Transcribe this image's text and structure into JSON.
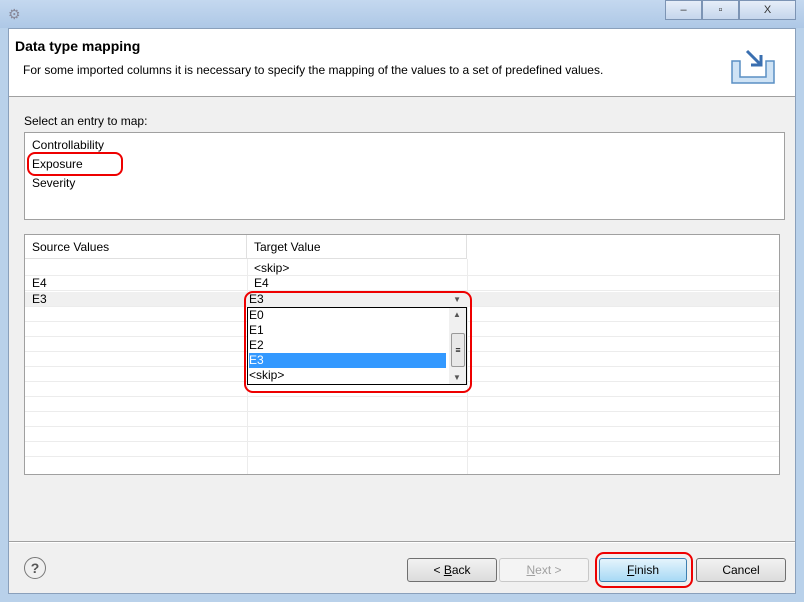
{
  "window": {
    "buttons": [
      "minimize",
      "maximize",
      "close"
    ]
  },
  "header": {
    "title": "Data type mapping",
    "description": "For some imported columns it is necessary to specify the mapping of the values to a set of predefined values."
  },
  "select_label": "Select an entry to map:",
  "entries": [
    "Controllability",
    "Exposure",
    "Severity"
  ],
  "table": {
    "columns": [
      "Source Values",
      "Target Value"
    ],
    "rows": [
      {
        "source": "",
        "target": "<skip>"
      },
      {
        "source": "E4",
        "target": "E4"
      },
      {
        "source": "E3",
        "target": "E3"
      }
    ]
  },
  "dropdown": {
    "options": [
      "E0",
      "E1",
      "E2",
      "E3",
      "<skip>"
    ],
    "selected": "E3"
  },
  "buttons": {
    "back_prefix": "< ",
    "back_u": "B",
    "back_rest": "ack",
    "next_u": "N",
    "next_rest": "ext >",
    "finish_u": "F",
    "finish_rest": "inish",
    "cancel": "Cancel",
    "help": "?"
  }
}
